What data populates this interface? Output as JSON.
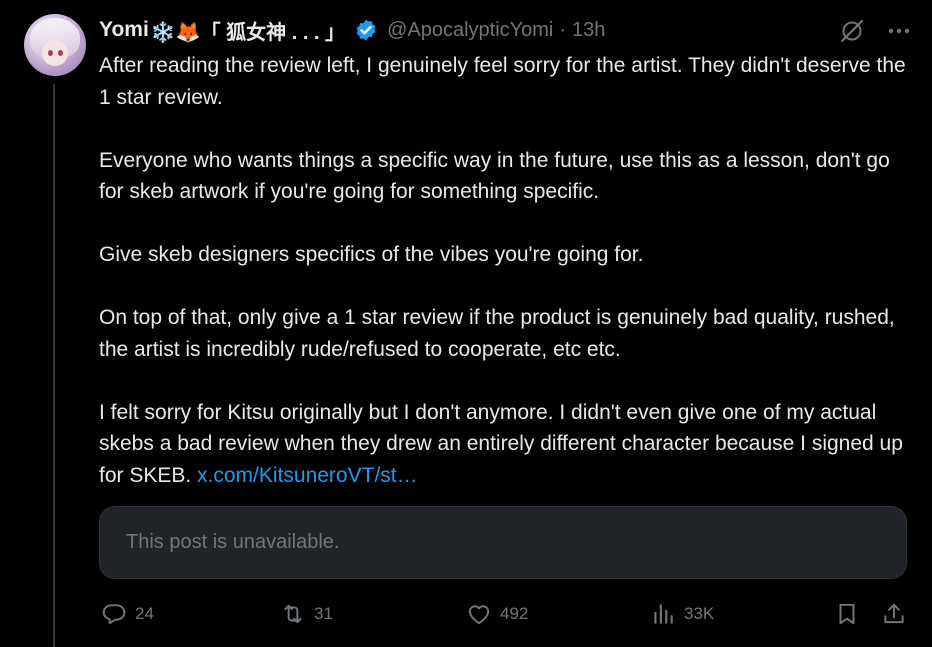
{
  "tweet": {
    "display_name": "Yomi",
    "name_emojis": "❄️🦊「 狐女神 . . . 」",
    "handle": "@ApocalypticYomi",
    "separator": "·",
    "time": "13h",
    "paragraphs": [
      "After reading the review left, I genuinely feel sorry for the artist. They didn't deserve the 1 star review.",
      "Everyone who wants things a specific way in the future, use this as a lesson, don't go for skeb artwork if you're going for something specific.",
      "Give skeb designers specifics of the vibes you're going for.",
      "On top of that, only give a 1 star review if the product is genuinely bad quality, rushed, the artist is incredibly rude/refused to cooperate, etc etc.",
      "I felt sorry for Kitsu originally but I don't anymore. I didn't even give one of my actual skebs a bad review when they drew an entirely different character because I signed up for SKEB."
    ],
    "link_text": "x.com/KitsuneroVT/st…",
    "quote_unavailable": "This post is unavailable."
  },
  "actions": {
    "replies": "24",
    "reposts": "31",
    "likes": "492",
    "views": "33K"
  },
  "colors": {
    "background": "#000000",
    "text": "#e7e9ea",
    "muted": "#71767b",
    "link": "#1d9bf0",
    "verified": "#1d9bf0"
  }
}
